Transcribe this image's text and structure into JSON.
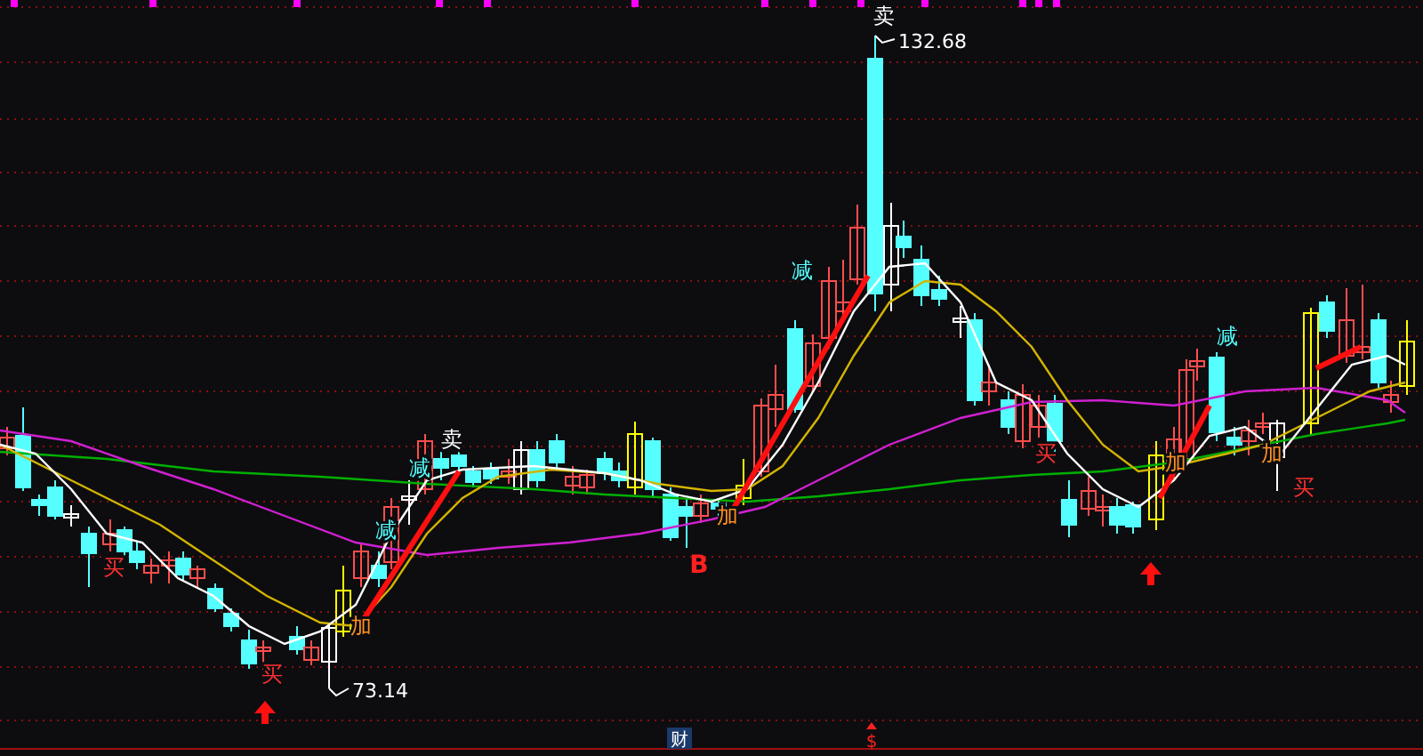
{
  "chart": {
    "price_labels": [
      {
        "kind": "high",
        "text": "132.68"
      },
      {
        "kind": "low",
        "text": "73.14"
      }
    ],
    "signals": [
      {
        "kind": "sell",
        "text": "卖"
      },
      {
        "kind": "sell",
        "text": "卖"
      },
      {
        "kind": "reduce",
        "text": "减"
      },
      {
        "kind": "reduce",
        "text": "减"
      },
      {
        "kind": "reduce",
        "text": "减"
      },
      {
        "kind": "reduce",
        "text": "减"
      },
      {
        "kind": "buy",
        "text": "买"
      },
      {
        "kind": "buy",
        "text": "买"
      },
      {
        "kind": "buy",
        "text": "买"
      },
      {
        "kind": "buy",
        "text": "买"
      },
      {
        "kind": "add",
        "text": "加"
      },
      {
        "kind": "add",
        "text": "加"
      },
      {
        "kind": "add",
        "text": "加"
      },
      {
        "kind": "add",
        "text": "加"
      },
      {
        "kind": "b_mark",
        "text": "B"
      }
    ],
    "bottom_markers": [
      {
        "kind": "finance",
        "text": "财"
      },
      {
        "kind": "dollar",
        "text": "$"
      }
    ]
  }
}
